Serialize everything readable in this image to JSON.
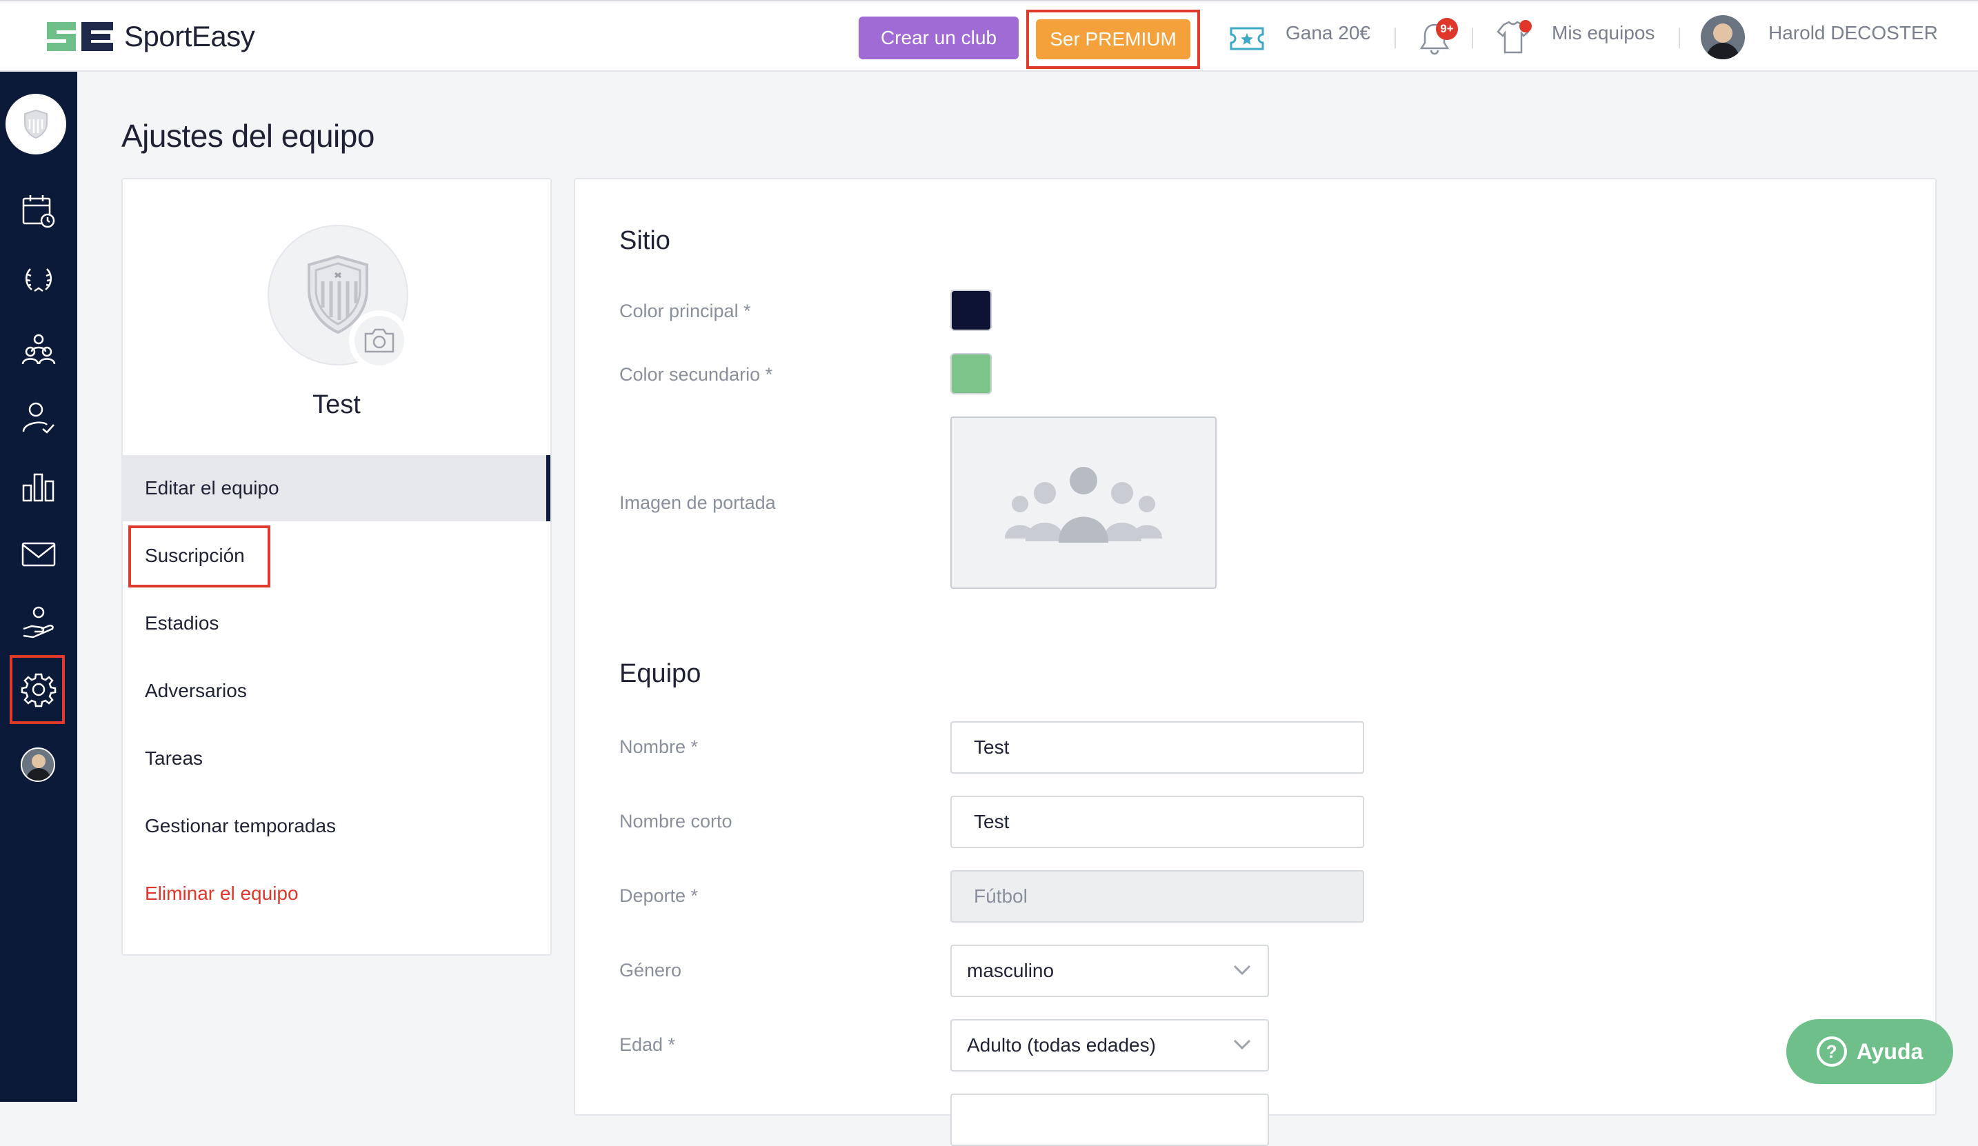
{
  "header": {
    "brand": "SportEasy",
    "create_club": "Crear un club",
    "premium": "Ser PREMIUM",
    "earn": "Gana 20€",
    "notification_badge": "9+",
    "my_teams": "Mis equipos",
    "user_name": "Harold DECOSTER"
  },
  "page": {
    "title": "Ajustes del equipo"
  },
  "team_card": {
    "name": "Test",
    "menu": [
      {
        "label": "Editar el equipo"
      },
      {
        "label": "Suscripción"
      },
      {
        "label": "Estadios"
      },
      {
        "label": "Adversarios"
      },
      {
        "label": "Tareas"
      },
      {
        "label": "Gestionar temporadas"
      },
      {
        "label": "Eliminar el equipo"
      }
    ]
  },
  "site": {
    "title": "Sitio",
    "primary_color_label": "Color principal *",
    "primary_color": "#0d1433",
    "secondary_color_label": "Color secundario *",
    "secondary_color": "#7cc48a",
    "cover_label": "Imagen de portada"
  },
  "team": {
    "title": "Equipo",
    "name_label": "Nombre *",
    "name_value": "Test",
    "short_name_label": "Nombre corto",
    "short_name_value": "Test",
    "sport_label": "Deporte *",
    "sport_value": "Fútbol",
    "gender_label": "Género",
    "gender_value": "masculino",
    "age_label": "Edad *",
    "age_value": "Adulto (todas edades)"
  },
  "help": {
    "label": "Ayuda"
  },
  "colors": {
    "sidebar": "#0c1a3a",
    "highlight": "#e03a2f",
    "premium": "#f4a13c",
    "club": "#a06bd5",
    "help": "#6fbf8a"
  }
}
